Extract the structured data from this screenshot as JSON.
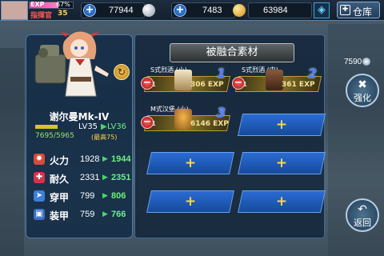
{
  "topbar": {
    "exp_label": "EXP",
    "exp_percent": "67%",
    "exp_fraction": 0.67,
    "commander_label": "指揮官",
    "commander_level": "35",
    "resources": [
      {
        "name": "oil",
        "value": "77944",
        "icon": "oil-icon"
      },
      {
        "name": "silver",
        "value": "7483",
        "icon": "silver-coin-icon"
      },
      {
        "name": "gold",
        "value": "63984",
        "icon": "gold-coin-icon"
      }
    ],
    "warehouse_label": "仓库"
  },
  "ship": {
    "name": "谢尔曼Mk-IV",
    "level_from": "LV35",
    "level_to": "LV36",
    "max_note": "(最高75)",
    "exp_current": "7695/5965",
    "stats": [
      {
        "label": "火力",
        "from": "1928",
        "to": "1944",
        "icon": "firepower-icon",
        "color": "#d94a3a"
      },
      {
        "label": "耐久",
        "from": "2331",
        "to": "2351",
        "icon": "durability-icon",
        "color": "#d4344a"
      },
      {
        "label": "穿甲",
        "from": "799",
        "to": "806",
        "icon": "penetration-icon",
        "color": "#3d7ed8"
      },
      {
        "label": "装甲",
        "from": "759",
        "to": "766",
        "icon": "armor-icon",
        "color": "#3a70c8"
      }
    ]
  },
  "materials_header": "被融合素材",
  "materials": [
    {
      "name": "S式烈酒 (小)",
      "count": "1",
      "exp": "306 EXP",
      "slot_number": "1",
      "icon": "liquor-small-icon"
    },
    {
      "name": "S式烈酒 (中)",
      "count": "1",
      "exp": "361 EXP",
      "slot_number": "2",
      "icon": "liquor-medium-icon"
    },
    {
      "name": "M式汉堡 (小)",
      "count": "1",
      "exp": "6146 EXP",
      "slot_number": "3",
      "icon": "burger-icon"
    }
  ],
  "empty_slot_symbol": "+",
  "side": {
    "count": "7590",
    "enhance_label": "强化",
    "back_label": "返回"
  }
}
